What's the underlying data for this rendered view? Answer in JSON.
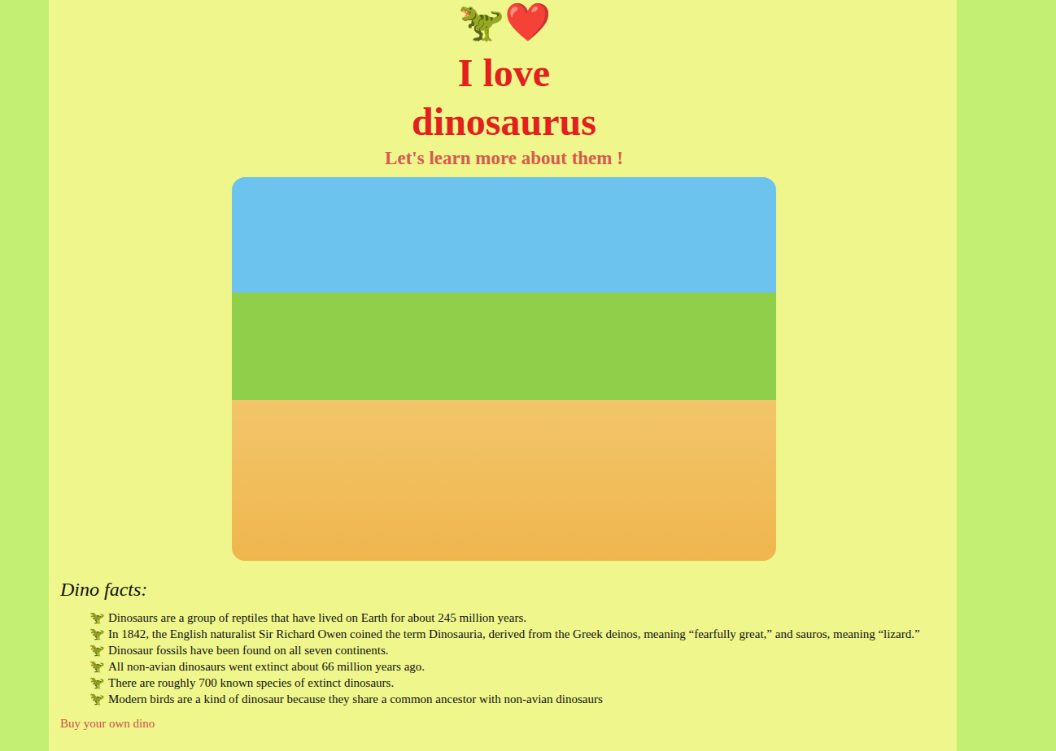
{
  "header": {
    "emoji": "🦖❤️",
    "title": "I love dinosaurus",
    "subtitle": "Let's learn more about them !"
  },
  "facts": {
    "heading": "Dino facts:",
    "bullet": "🦖",
    "items": [
      "Dinosaurs are a group of reptiles that have lived on Earth for about 245 million years.",
      "In 1842, the English naturalist Sir Richard Owen coined the term Dinosauria, derived from the Greek deinos, meaning “fearfully great,” and sauros, meaning “lizard.”",
      "Dinosaur fossils have been found on all seven continents.",
      "All non-avian dinosaurs went extinct about 66 million years ago.",
      "There are roughly 700 known species of extinct dinosaurs.",
      "Modern birds are a kind of dinosaur because they share a common ancestor with non-avian dinosaurs"
    ]
  },
  "link": "Buy your own dino"
}
